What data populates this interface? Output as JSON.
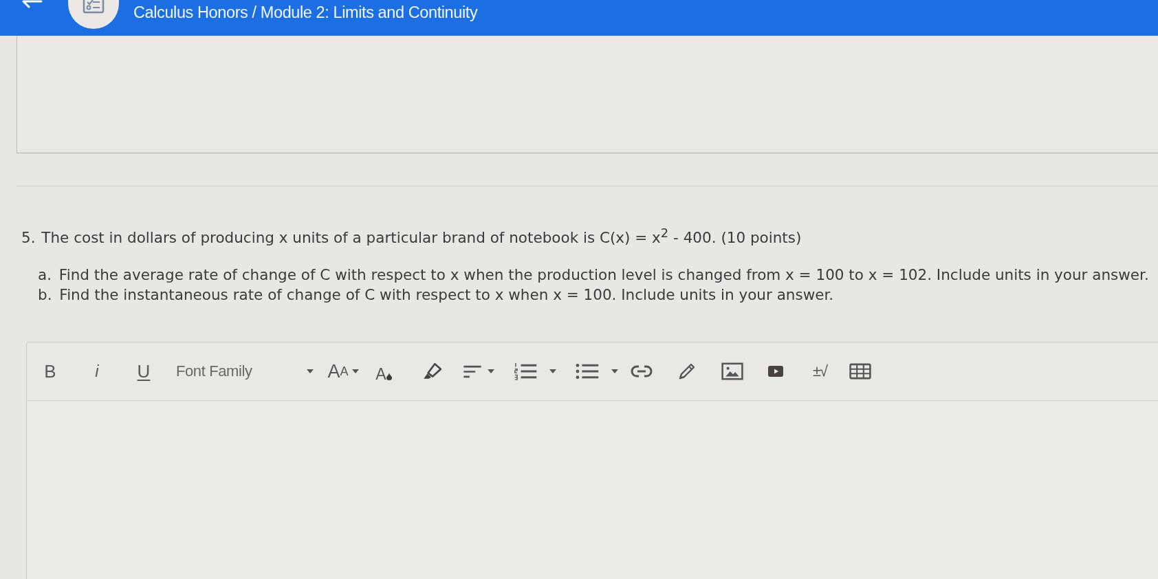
{
  "header": {
    "title": "Calculus Honors / Module 2: Limits and Continuity"
  },
  "question": {
    "number": "5.",
    "text": "The cost in dollars of producing x units of a particular brand of notebook is C(x) = x$^{2}$ - 400. (10 points)",
    "parts": [
      {
        "label": "a.",
        "text": "Find the average rate of change of C with respect to x when the production level is changed from x = 100 to x = 102. Include units in your answer."
      },
      {
        "label": "b.",
        "text": "Find the instantaneous rate of change of C with respect to x when x = 100. Include units in your answer."
      }
    ]
  },
  "editor": {
    "toolbar": [
      {
        "kind": "bold",
        "label": "B",
        "dropdown": false
      },
      {
        "kind": "italic",
        "label": "i",
        "dropdown": false
      },
      {
        "kind": "underline",
        "label": "U",
        "dropdown": false
      },
      {
        "kind": "font-family",
        "placeholder": "Font Family",
        "dropdown": true
      },
      {
        "kind": "font-size",
        "label": "A",
        "sub_label": "A",
        "dropdown": true
      },
      {
        "kind": "font-color",
        "label": "A",
        "dropdown": false
      },
      {
        "kind": "highlight",
        "dropdown": false
      },
      {
        "kind": "align",
        "dropdown": true
      },
      {
        "kind": "ordered-list",
        "dropdown": true
      },
      {
        "kind": "unordered-list",
        "dropdown": true
      },
      {
        "kind": "link",
        "dropdown": false
      },
      {
        "kind": "draw",
        "dropdown": false
      },
      {
        "kind": "image",
        "dropdown": false
      },
      {
        "kind": "video",
        "dropdown": false
      },
      {
        "kind": "math",
        "label": "±√",
        "dropdown": false
      },
      {
        "kind": "table",
        "dropdown": false
      }
    ]
  }
}
